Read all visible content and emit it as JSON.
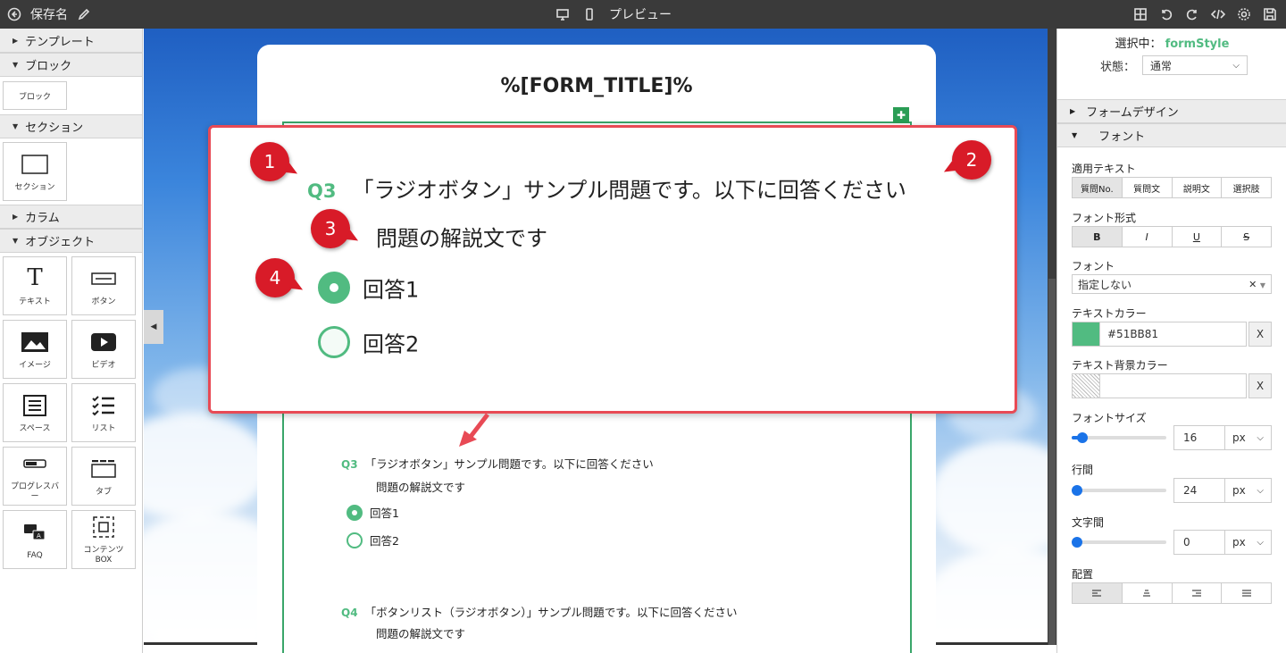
{
  "topbar": {
    "save_name": "保存名",
    "preview_label": "プレビュー"
  },
  "left_panel": {
    "template_label": "テンプレート",
    "block_label": "ブロック",
    "block_tile": "ブロック",
    "section_label": "セクション",
    "section_tile": "セクション",
    "column_label": "カラム",
    "object_label": "オブジェクト",
    "objects": [
      "テキスト",
      "ボタン",
      "イメージ",
      "ビデオ",
      "スペース",
      "リスト",
      "プログレスバー",
      "タブ",
      "FAQ",
      "コンテンツBOX"
    ]
  },
  "form": {
    "title": "%[FORM_TITLE]%",
    "q3": {
      "no": "Q3",
      "text": "「ラジオボタン」サンプル問題です。以下に回答ください",
      "desc": "問題の解説文です",
      "options": [
        "回答1",
        "回答2"
      ]
    },
    "q4": {
      "no": "Q4",
      "text": "「ボタンリスト（ラジオボタン）」サンプル問題です。以下に回答ください",
      "desc": "問題の解説文です"
    }
  },
  "zoom": {
    "badges": [
      "1",
      "2",
      "3",
      "4"
    ]
  },
  "right_panel": {
    "selected_label": "選択中：",
    "selected_value": "formStyle",
    "state_label": "状態：",
    "state_value": "通常",
    "form_design_label": "フォームデザイン",
    "font_label": "フォント",
    "apply_text_label": "適用テキスト",
    "apply_options": [
      "質問No.",
      "質問文",
      "説明文",
      "選択肢"
    ],
    "font_format_label": "フォント形式",
    "font_format_options": [
      "B",
      "I",
      "U",
      "S"
    ],
    "font_family_label": "フォント",
    "font_family_value": "指定しない",
    "text_color_label": "テキストカラー",
    "text_color_value": "#51BB81",
    "text_bg_label": "テキスト背景カラー",
    "text_bg_value": "",
    "font_size_label": "フォントサイズ",
    "font_size_value": "16",
    "line_height_label": "行間",
    "line_height_value": "24",
    "letter_spacing_label": "文字間",
    "letter_spacing_value": "0",
    "unit": "px",
    "align_label": "配置",
    "x_label": "X"
  },
  "colors": {
    "accent": "#51BB81",
    "badge": "#d81b28",
    "highlight_border": "#e84a55"
  }
}
